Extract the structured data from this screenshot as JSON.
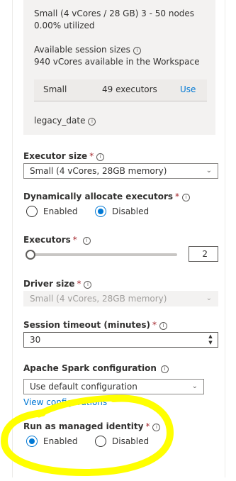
{
  "pool_info": {
    "size_summary": "Small (4 vCores / 28 GB) 3 - 50 nodes",
    "utilization": "0.00% utilized",
    "available_sizes_label": "Available session sizes",
    "available_sizes_detail": "940 vCores available in the Workspace",
    "size_row": {
      "name": "Small",
      "executors": "49 executors",
      "action": "Use"
    },
    "legacy_label": "legacy_date"
  },
  "form": {
    "executor_size": {
      "label": "Executor size",
      "required": "*",
      "value": "Small (4 vCores, 28GB memory)"
    },
    "dynamic_allocate": {
      "label": "Dynamically allocate executors",
      "required": "*",
      "options": [
        "Enabled",
        "Disabled"
      ],
      "selected": "Disabled"
    },
    "executors": {
      "label": "Executors",
      "required": "*",
      "value": "2"
    },
    "driver_size": {
      "label": "Driver size",
      "required": "*",
      "value": "Small (4 vCores, 28GB memory)"
    },
    "session_timeout": {
      "label": "Session timeout (minutes)",
      "required": "*",
      "value": "30"
    },
    "spark_config": {
      "label": "Apache Spark configuration",
      "value": "Use default configuration",
      "link": "View configurations"
    },
    "managed_identity": {
      "label": "Run as managed identity",
      "required": "*",
      "options": [
        "Enabled",
        "Disabled"
      ],
      "selected": "Enabled"
    }
  },
  "icons": {
    "info": "info-icon",
    "dropdown": "chevron-down-icon",
    "spin_up": "chevron-up-icon",
    "spin_down": "chevron-down-icon"
  },
  "colors": {
    "accent": "#0078d4",
    "required": "#a4262c",
    "annotation": "#ffff00",
    "disabled_text": "#a19f9d"
  }
}
